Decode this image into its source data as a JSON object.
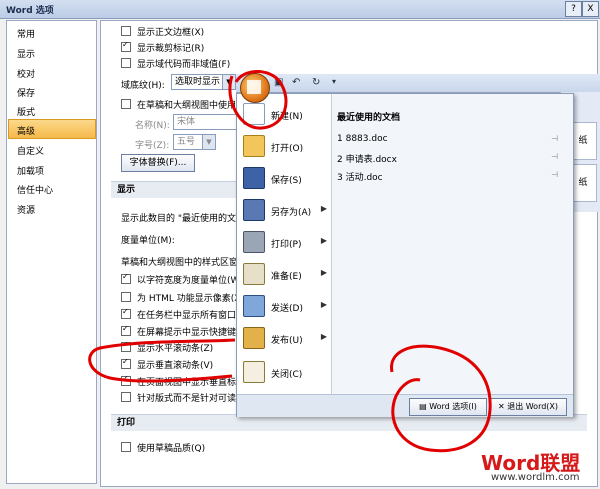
{
  "window": {
    "title": "Word 选项",
    "help_btn": "?",
    "close_btn": "X"
  },
  "nav": {
    "items": [
      "常用",
      "显示",
      "校对",
      "保存",
      "版式",
      "高级",
      "自定义",
      "加载项",
      "信任中心",
      "资源"
    ],
    "selected_index": 5
  },
  "main": {
    "opts_top": [
      {
        "label": "显示正文边框(X)",
        "checked": false
      },
      {
        "label": "显示裁剪标记(R)",
        "checked": true
      },
      {
        "label": "显示域代码而非域值(F)",
        "checked": false
      }
    ],
    "field_shading_label": "域底纹(H):",
    "field_shading_value": "选取时显示",
    "draft_font_label": "在草稿和大纲视图中使用草",
    "name_label": "名称(N):",
    "name_value": "宋体",
    "size_label": "字号(Z):",
    "size_value": "五号",
    "font_sub_btn": "字体替换(F)...",
    "section_display": "显示",
    "recent_docs_label": "显示此数目的 \"最近使用的文",
    "units_label": "度量单位(M):",
    "style_area_label": "草稿和大纲视图中的样式区窗",
    "opts_display": [
      {
        "label": "以字符宽度为度量单位(W)",
        "checked": true
      },
      {
        "label": "为 HTML 功能显示像素(X)",
        "checked": false
      },
      {
        "label": "在任务栏中显示所有窗口(I)",
        "checked": true
      },
      {
        "label": "在屏幕提示中显示快捷键(H)",
        "checked": true
      },
      {
        "label": "显示水平滚动条(Z)",
        "checked": true
      },
      {
        "label": "显示垂直滚动条(V)",
        "checked": true
      },
      {
        "label": "在页面视图中显示垂直标尺",
        "checked": true
      },
      {
        "label": "针对版式而不是针对可读性",
        "checked": false
      }
    ],
    "section_print": "打印",
    "print_opts": [
      {
        "label": "使用草稿品质(Q)",
        "checked": false
      }
    ]
  },
  "office_menu": {
    "items": [
      {
        "label": "新建(N)",
        "sub": ""
      },
      {
        "label": "打开(O)",
        "sub": ""
      },
      {
        "label": "保存(S)",
        "sub": ""
      },
      {
        "label": "另存为(A)",
        "sub": "▶"
      },
      {
        "label": "打印(P)",
        "sub": "▶"
      },
      {
        "label": "准备(E)",
        "sub": "▶"
      },
      {
        "label": "发送(D)",
        "sub": "▶"
      },
      {
        "label": "发布(U)",
        "sub": "▶"
      },
      {
        "label": "关闭(C)",
        "sub": ""
      }
    ],
    "recent_title": "最近使用的文档",
    "recent": [
      "1  8883.doc",
      "2  申请表.docx",
      "3  活动.doc"
    ],
    "options_btn": "Word 选项(I)",
    "exit_btn": "退出 Word(X)"
  },
  "ribbon_right": [
    "纸",
    "纸"
  ],
  "watermark": {
    "brand": "Word联盟",
    "url": "www.wordlm.com"
  },
  "colors": {
    "annotation": "#e00000",
    "selected_nav": "#f6b94a"
  }
}
